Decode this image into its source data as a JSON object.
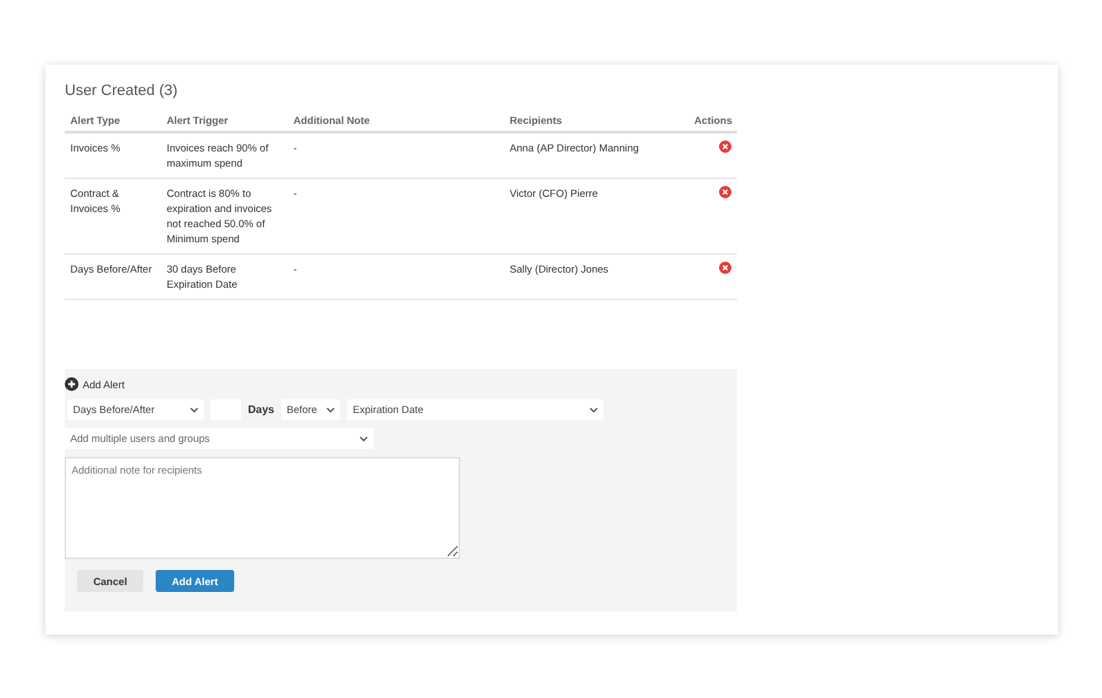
{
  "section": {
    "title": "User Created (3)"
  },
  "table": {
    "columns": [
      "Alert Type",
      "Alert Trigger",
      "Additional Note",
      "Recipients",
      "Actions"
    ],
    "rows": [
      {
        "type": "Invoices %",
        "trigger": "Invoices reach 90% of maximum spend",
        "note": "-",
        "recipients": "Anna (AP Director) Manning"
      },
      {
        "type": "Contract & Invoices %",
        "trigger": "Contract is 80% to expiration and invoices not reached 50.0% of Minimum spend",
        "note": "-",
        "recipients": "Victor (CFO) Pierre"
      },
      {
        "type": "Days Before/After",
        "trigger": "30 days Before Expiration Date",
        "note": "-",
        "recipients": "Sally (Director) Jones"
      }
    ]
  },
  "add_alert": {
    "label": "Add Alert",
    "alert_type": {
      "value": "Days Before/After"
    },
    "days": {
      "label": "Days"
    },
    "direction": {
      "value": "Before"
    },
    "date_field": {
      "value": "Expiration Date"
    },
    "recipients": {
      "placeholder": "Add multiple users and groups"
    },
    "note": {
      "placeholder": "Additional note for recipients"
    },
    "buttons": [
      {
        "label": "Cancel",
        "kind": "secondary"
      },
      {
        "label": "Add Alert",
        "kind": "primary"
      }
    ]
  }
}
